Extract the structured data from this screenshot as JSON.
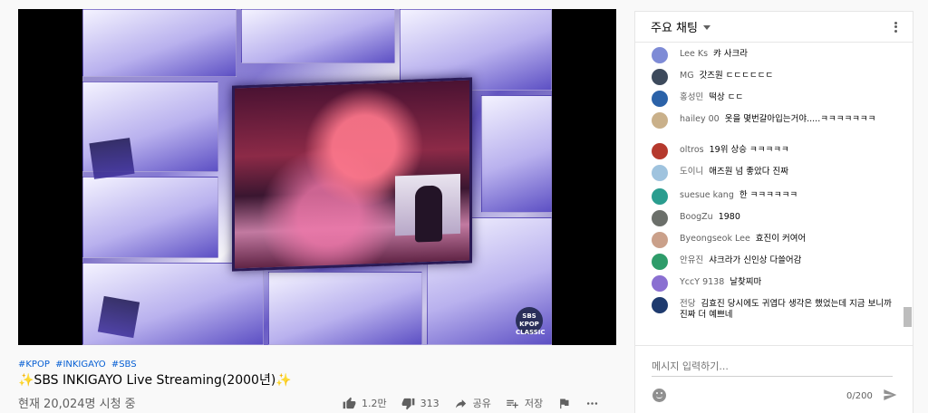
{
  "video": {
    "watermark": "SBS KPOP CLASSIC"
  },
  "info": {
    "hashtags": [
      "#KPOP",
      "#INKIGAYO",
      "#SBS"
    ],
    "title": "✨SBS INKIGAYO Live Streaming(2000년)✨",
    "views": "현재 20,024명 시청 중"
  },
  "actions": {
    "like_count": "1.2만",
    "dislike_count": "313",
    "share_label": "공유",
    "save_label": "저장"
  },
  "chat": {
    "mode_label": "주요 채팅",
    "messages": [
      {
        "author": "Lee Ks",
        "text": "캬 사크라",
        "avatar_color": "#7e8bd6"
      },
      {
        "author": "MG",
        "text": "갓즈원 ㄷㄷㄷㄷㄷㄷ",
        "avatar_color": "#3d4a5c"
      },
      {
        "author": "홍성민",
        "text": "떡상 ㄷㄷ",
        "avatar_color": "#2b62a8"
      },
      {
        "author": "hailey 00",
        "text": "옷을 몇번갈아입는거야.....ㅋㅋㅋㅋㅋㅋㅋ",
        "avatar_color": "#c9b08a"
      },
      {
        "author": "oltros",
        "text": "19위 상승 ㅋㅋㅋㅋㅋ",
        "avatar_color": "#b5392d"
      },
      {
        "author": "도이니",
        "text": "애즈원 넘 좋았다 진짜",
        "avatar_color": "#9fc3de"
      },
      {
        "author": "suesue kang",
        "text": "한 ㅋㅋㅋㅋㅋㅋ",
        "avatar_color": "#2a9d8f"
      },
      {
        "author": "BoogZu",
        "text": "1980",
        "avatar_color": "#6b6f6a"
      },
      {
        "author": "Byeongseok Lee",
        "text": "효진이 커여어",
        "avatar_color": "#caa08a"
      },
      {
        "author": "안유진",
        "text": "샤크라가 신인상 다쓸어감",
        "avatar_color": "#2e9c6a"
      },
      {
        "author": "YccY 9138",
        "text": "날찾찌마",
        "avatar_color": "#8a6fd1"
      },
      {
        "author": "전당",
        "text": "김효진 당시에도 귀엽다 생각은 했었는데 지금 보니까 진짜 더 예쁘네",
        "avatar_color": "#1e3a6e"
      }
    ],
    "input_placeholder": "메시지 입력하기...",
    "char_counter": "0/200"
  },
  "icons": {
    "like": "thumbs-up-icon",
    "dislike": "thumbs-down-icon",
    "share": "share-icon",
    "save": "playlist-add-icon",
    "report": "flag-icon",
    "more": "more-horizontal-icon",
    "menu": "more-vertical-icon",
    "emoji": "emoji-icon",
    "send": "send-icon"
  }
}
